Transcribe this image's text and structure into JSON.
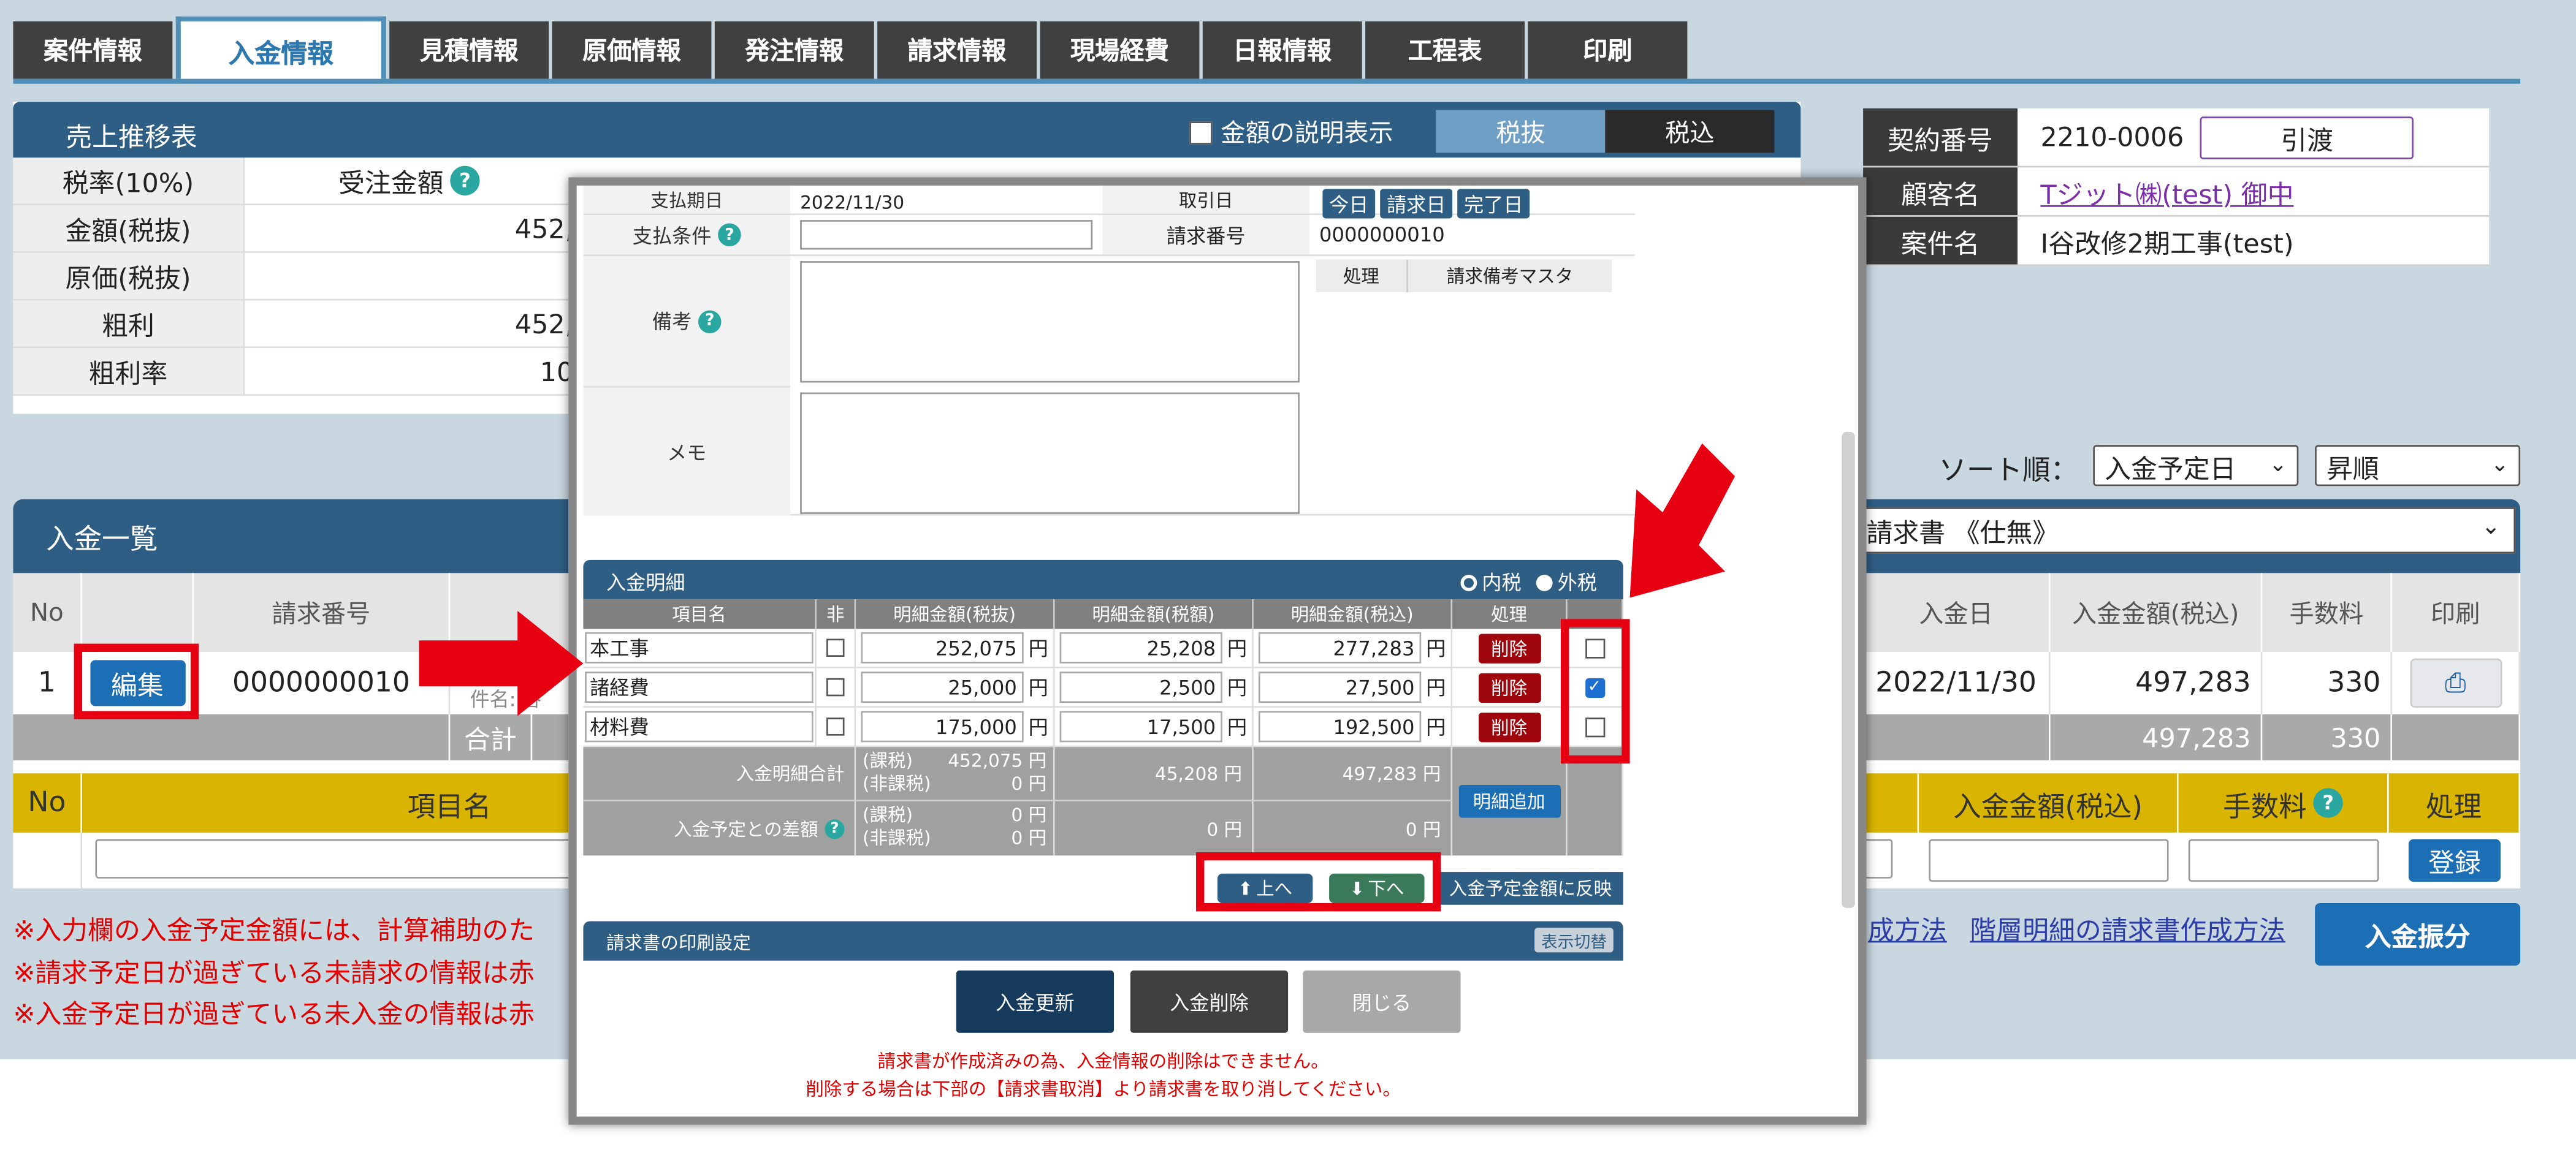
{
  "tabs": [
    "案件情報",
    "入金情報",
    "見積情報",
    "原価情報",
    "発注情報",
    "請求情報",
    "現場経費",
    "日報情報",
    "工程表",
    "印刷"
  ],
  "sales": {
    "title": "売上推移表",
    "show_amount_desc": "金額の説明表示",
    "tax_excl": "税抜",
    "tax_incl": "税込",
    "tax_rate_label": "税率(10%)",
    "order_amount_label": "受注金額",
    "rows": [
      {
        "label": "金額(税抜)",
        "value": "452,"
      },
      {
        "label": "原価(税抜)",
        "value": ""
      },
      {
        "label": "粗利",
        "value": "452,"
      },
      {
        "label": "粗利率",
        "value": "10"
      }
    ]
  },
  "contract": {
    "no_label": "契約番号",
    "no_value": "2210-0006",
    "handover": "引渡",
    "customer_label": "顧客名",
    "customer_value": "Tジット㈱(test) 御中",
    "project_label": "案件名",
    "project_value": "I谷改修2期工事(test)"
  },
  "sort": {
    "label": "ソート順：",
    "key": "入金予定日",
    "order": "昇順"
  },
  "payment_list": {
    "title": "入金一覧",
    "invoice_select": "請求書 《仕無》",
    "headers": {
      "no": "No",
      "invoice_no": "請求番号",
      "pay_date": "入金日",
      "amount": "入金金額(税込)",
      "fee": "手数料",
      "print": "印刷"
    },
    "row": {
      "no": "1",
      "edit": "編集",
      "invoice_no": "0000000010",
      "subject": "件名:I谷",
      "pay_date": "2022/11/30",
      "amount": "497,283",
      "fee": "330"
    },
    "total_label": "合計",
    "total_amount": "497,283",
    "total_fee": "330",
    "entry_headers": {
      "no": "No",
      "item": "項目名",
      "amount": "入金金額(税込)",
      "fee": "手数料",
      "action": "処理"
    },
    "register": "登録"
  },
  "notes": [
    "※入力欄の入金予定金額には、計算補助のた",
    "※請求予定日が過ぎている未請求の情報は赤",
    "※入金予定日が過ぎている未入金の情報は赤"
  ],
  "links": {
    "method1": "成方法",
    "method2": "階層明細の請求書作成方法"
  },
  "allot_button": "入金振分",
  "modal": {
    "pay_date_label": "支払期日",
    "pay_date_value": "2022/11/30",
    "pay_date_label2": "取引日",
    "today": "今日",
    "invoice_date": "請求日",
    "done_date": "完了日",
    "pay_cond_label": "支払条件",
    "invoice_no_label": "請求番号",
    "invoice_no_value": "0000000010",
    "proc_label": "処理",
    "remark_master": "請求備考マスタ",
    "remarks_label": "備考",
    "memo_label": "メモ",
    "detail_title": "入金明細",
    "tax_in": "内税",
    "tax_out": "外税",
    "dheaders": {
      "item": "項目名",
      "nontax": "非",
      "excl": "明細金額(税抜)",
      "tax": "明細金額(税額)",
      "incl": "明細金額(税込)",
      "proc": "処理"
    },
    "yen": "円",
    "delete": "削除",
    "rows": [
      {
        "item": "本工事",
        "excl": "252,075",
        "tax": "25,208",
        "incl": "277,283",
        "checked": false
      },
      {
        "item": "諸経費",
        "excl": "25,000",
        "tax": "2,500",
        "incl": "27,500",
        "checked": true
      },
      {
        "item": "材料費",
        "excl": "175,000",
        "tax": "17,500",
        "incl": "192,500",
        "checked": false
      }
    ],
    "sum_label": "入金明細合計",
    "taxed": "(課税)",
    "nontaxed": "(非課税)",
    "sum_taxed": "452,075 円",
    "sum_nontaxed": "0 円",
    "sum_tax": "45,208 円",
    "sum_incl": "497,283 円",
    "add_detail": "明細追加",
    "diff_label": "入金予定との差額",
    "diff_taxed": "0 円",
    "diff_nontaxed": "0 円",
    "diff_tax": "0 円",
    "diff_incl": "0 円",
    "up": "上へ",
    "down": "下へ",
    "reflect": "入金予定金額に反映",
    "print_settings": "請求書の印刷設定",
    "toggle": "表示切替",
    "update": "入金更新",
    "remove": "入金削除",
    "close": "閉じる",
    "msg1": "請求書が作成済みの為、入金情報の削除はできません。",
    "msg2": "削除する場合は下部の【請求書取消】より請求書を取り消してください。"
  },
  "colors": {
    "header_blue": "#2f5e84",
    "highlight_red": "#e60012",
    "accent_yellow": "#d9b400",
    "delete_red": "#a0070c"
  }
}
